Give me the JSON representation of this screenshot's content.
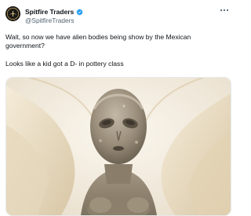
{
  "tweet": {
    "author": {
      "display_name": "Spitfire Traders",
      "handle": "@SpitfireTraders",
      "verified": true,
      "avatar_icon": "spitfire-logo-avatar"
    },
    "more_icon": "more-options-icon",
    "text_line_1": "Wait, so now we have alien bodies being show by the Mexican government?",
    "text_line_2": "Looks like a kid got a D- in pottery class",
    "media": {
      "type": "photo",
      "icon": "alien-figure-photo"
    }
  },
  "colors": {
    "verified_blue": "#1d9bf0",
    "handle_gray": "#536471",
    "text": "#0f1419"
  }
}
